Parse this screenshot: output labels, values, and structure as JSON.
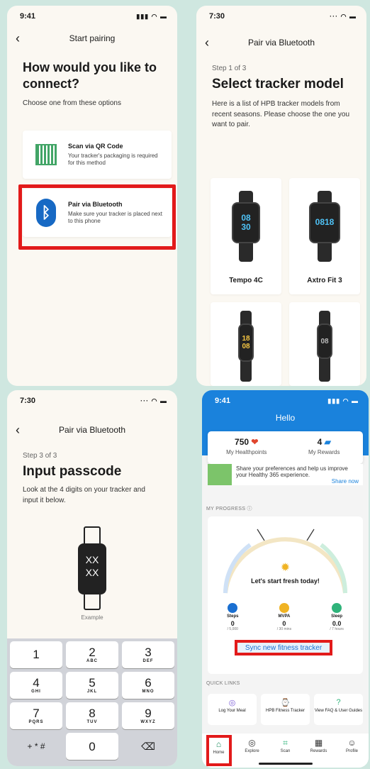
{
  "screen1": {
    "time": "9:41",
    "nav_title": "Start pairing",
    "heading": "How would you like to connect?",
    "subtitle": "Choose one from these options",
    "options": [
      {
        "title": "Scan via QR Code",
        "desc": "Your tracker's packaging is required for this method",
        "icon": "qr-code-icon"
      },
      {
        "title": "Pair via Bluetooth",
        "desc": "Make sure your tracker is placed next to this phone",
        "icon": "bluetooth-icon"
      }
    ]
  },
  "screen2": {
    "time": "7:30",
    "nav_title": "Pair via Bluetooth",
    "step": "Step 1 of 3",
    "heading": "Select tracker model",
    "desc": "Here is a list of HPB tracker models from recent seasons. Please choose the one you want to pair.",
    "trackers": [
      {
        "name": "Tempo 4C",
        "face": "08\n30"
      },
      {
        "name": "Axtro Fit 3",
        "face": "0818"
      },
      {
        "name": "",
        "face": "18\n08"
      },
      {
        "name": "",
        "face": "08"
      }
    ]
  },
  "screen3": {
    "time": "7:30",
    "nav_title": "Pair via Bluetooth",
    "step": "Step 3 of 3",
    "heading": "Input passcode",
    "desc": "Look at the 4 digits on your tracker and input it below.",
    "watch_text_1": "XX",
    "watch_text_2": "XX",
    "example_label": "Example",
    "keys": [
      [
        {
          "n": "1",
          "l": ""
        },
        {
          "n": "2",
          "l": "ABC"
        },
        {
          "n": "3",
          "l": "DEF"
        }
      ],
      [
        {
          "n": "4",
          "l": "GHI"
        },
        {
          "n": "5",
          "l": "JKL"
        },
        {
          "n": "6",
          "l": "MNO"
        }
      ],
      [
        {
          "n": "7",
          "l": "PQRS"
        },
        {
          "n": "8",
          "l": "TUV"
        },
        {
          "n": "9",
          "l": "WXYZ"
        }
      ],
      [
        {
          "n": "+ * #",
          "l": ""
        },
        {
          "n": "0",
          "l": ""
        },
        {
          "n": "⌫",
          "l": ""
        }
      ]
    ]
  },
  "screen4": {
    "time": "9:41",
    "title": "Hello",
    "healthpoints_value": "750",
    "healthpoints_label": "My Healthpoints",
    "rewards_value": "4",
    "rewards_label": "My Rewards",
    "banner_text": "Share your preferences and help us improve your Healthy 365 experience.",
    "banner_link": "Share now",
    "progress_label": "MY PROGRESS ⓘ",
    "progress_message": "Let's start fresh today!",
    "stats": [
      {
        "label": "Steps",
        "value": "0",
        "goal": "/ 5,000",
        "color": "#1a6fd1"
      },
      {
        "label": "MVPA",
        "value": "0",
        "goal": "/ 30 mins",
        "color": "#f0b323"
      },
      {
        "label": "Sleep",
        "value": "0.0",
        "goal": "/ 7 hours",
        "color": "#2fb37a"
      }
    ],
    "sync_label": "Sync new fitness tracker",
    "quick_links_label": "QUICK LINKS",
    "quick_links": [
      {
        "label": "Log Your Meal",
        "icon": "meal-icon"
      },
      {
        "label": "HPB Fitness Tracker",
        "icon": "watch-icon"
      },
      {
        "label": "View FAQ & User Guides",
        "icon": "help-icon"
      }
    ],
    "tabs": [
      "Home",
      "Explore",
      "Scan",
      "Rewards",
      "Profile"
    ]
  }
}
